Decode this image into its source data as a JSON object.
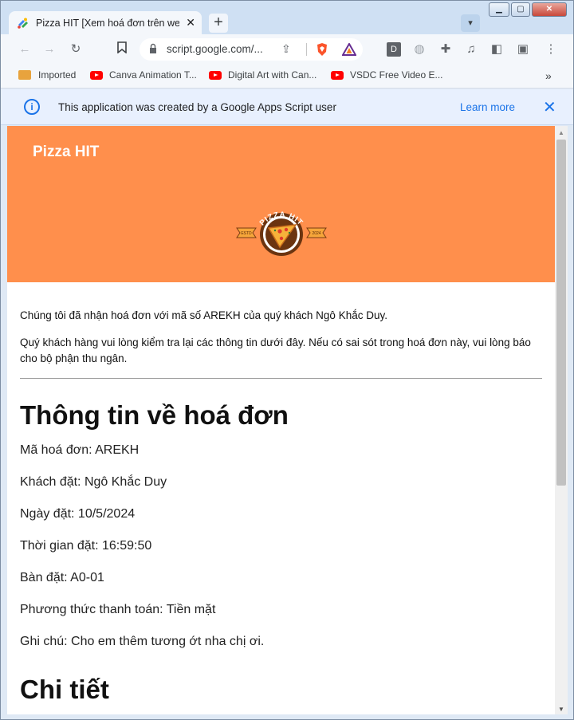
{
  "browser": {
    "tab_title": "Pizza HIT [Xem hoá đơn trên web]",
    "tab_close": "✕",
    "new_tab": "+",
    "url": "script.google.com/...",
    "bookmarks": [
      {
        "label": "Imported",
        "icon": "folder-icon"
      },
      {
        "label": "Canva Animation T...",
        "icon": "youtube-icon"
      },
      {
        "label": "Digital Art with Can...",
        "icon": "youtube-icon"
      },
      {
        "label": "VSDC Free Video E...",
        "icon": "youtube-icon"
      }
    ],
    "more_bookmarks": "»",
    "extension_letter": "D",
    "colors": {
      "accent": "#1a73e8",
      "tabstrip": "#cfe0f3",
      "youtube": "#ff0000"
    }
  },
  "infobar": {
    "message": "This application was created by a Google Apps Script user",
    "learn_more": "Learn more",
    "close": "✕"
  },
  "page": {
    "brand": "Pizza HIT",
    "logo_text": "PIZZA HIT",
    "logo_estd": "ESTD",
    "logo_year": "2024",
    "hero_color": "#ff8f4c",
    "intro": "Chúng tôi đã nhận hoá đơn với mã số AREKH của quý khách Ngô Khắc Duy.",
    "notice": "Quý khách hàng vui lòng kiểm tra lại các thông tin dưới đây. Nếu có sai sót trong hoá đơn này, vui lòng báo cho bộ phận thu ngân.",
    "section_title": "Thông tin về hoá đơn",
    "fields": [
      "Mã hoá đơn: AREKH",
      "Khách đặt: Ngô Khắc Duy",
      "Ngày đặt: 10/5/2024",
      "Thời gian đặt: 16:59:50",
      "Bàn đặt: A0-01",
      "Phương thức thanh toán: Tiền mặt",
      "Ghi chú: Cho em thêm tương ớt nha chị ơi."
    ],
    "details_title": "Chi tiết"
  }
}
